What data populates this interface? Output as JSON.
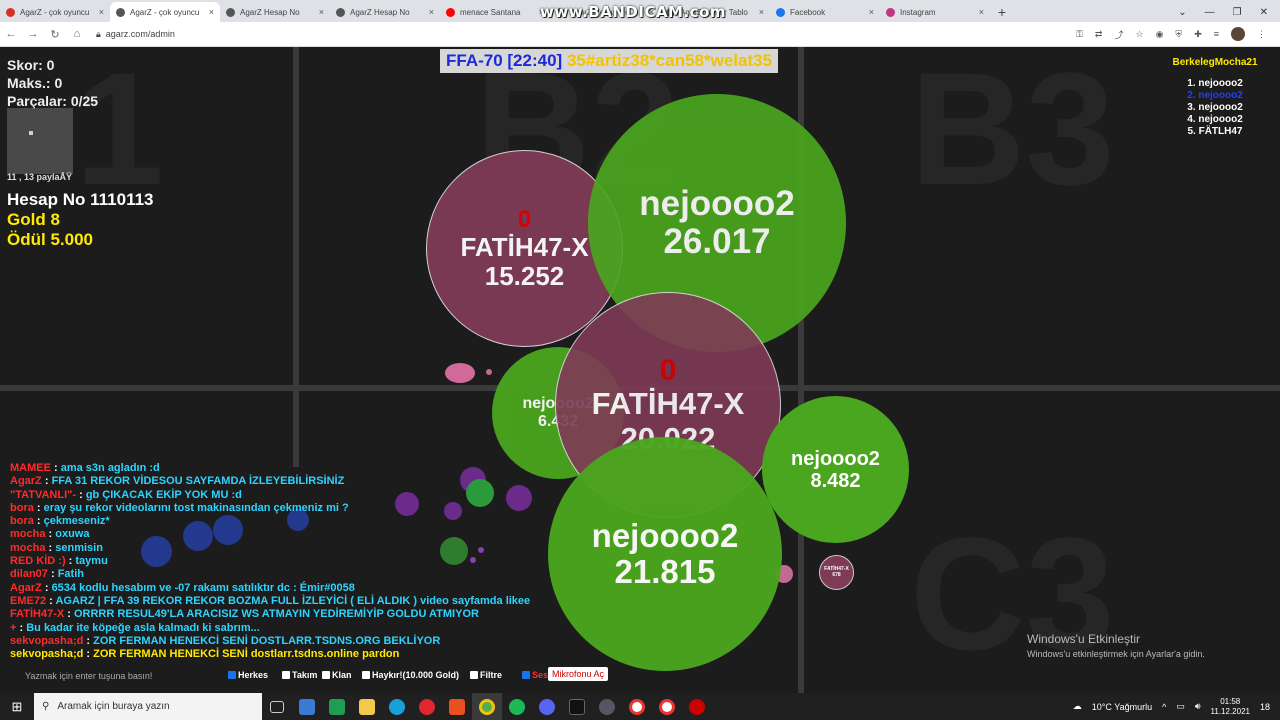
{
  "browser": {
    "tabs": [
      {
        "label": "AgarZ - çok oyuncu",
        "favicon": "#d93025",
        "active": false
      },
      {
        "label": "AgarZ - çok oyuncu",
        "favicon": "#555555",
        "active": true
      },
      {
        "label": "AgarZ Hesap No",
        "favicon": "#555555",
        "active": false
      },
      {
        "label": "AgarZ Hesap No",
        "favicon": "#555555",
        "active": false
      },
      {
        "label": "menace Santana",
        "favicon": "#ff0000",
        "active": false
      },
      {
        "label": "AgarZ Hesap No",
        "favicon": "#555555",
        "active": false
      },
      {
        "label": "AgarZ - Onur Tablo",
        "favicon": "#555555",
        "active": false
      },
      {
        "label": "Facebook",
        "favicon": "#1877f2",
        "active": false
      },
      {
        "label": "Instagram",
        "favicon": "#c13584",
        "active": false
      }
    ],
    "new_tab": "+",
    "window_controls": [
      "⌄",
      "—",
      "❐",
      "✕"
    ],
    "url": "agarz.com/admin",
    "watermark": "www.BANDICAM.com"
  },
  "hud": {
    "score": "Skor: 0",
    "max": "Maks.: 0",
    "pieces": "Parçalar: 0/25",
    "coords": "11 , 13 paylaÅŸ",
    "account": "Hesap No 1110113",
    "gold": "Gold 8",
    "reward": "Ödül 5.000"
  },
  "server_title": {
    "mode": "FFA-70 [22:40]",
    "names": "35#artiz38*can58*welat35"
  },
  "leaderboard": {
    "title": "BerkelegMocha21",
    "entries": [
      "1. nejoooo2",
      "2. nejoooo2",
      "3. nejoooo2",
      "4. nejoooo2",
      "5. FÄTLH47"
    ]
  },
  "cells": [
    {
      "name": "FATİH47-X",
      "mass": "15.252",
      "count": "0",
      "color": "#7f3b56"
    },
    {
      "name": "nejoooo2",
      "mass": "26.017",
      "count": "",
      "color": "#4aa61e"
    },
    {
      "name": "FATİH47-X",
      "mass": "20.022",
      "count": "0",
      "color": "#7f3b56"
    },
    {
      "name": "nejoooo2",
      "mass": "6.432",
      "count": "",
      "color": "#4aa61e"
    },
    {
      "name": "nejoooo2",
      "mass": "8.482",
      "count": "",
      "color": "#4aa61e"
    },
    {
      "name": "nejoooo2",
      "mass": "21.815",
      "count": "",
      "color": "#4aa61e"
    },
    {
      "name": "FATİH47-X",
      "mass": "678",
      "count": "",
      "color": "#7f3b56"
    }
  ],
  "sectors": [
    "1",
    "B2",
    "B3",
    "C3"
  ],
  "chat": [
    {
      "who": "MAMEE",
      "color": "#ff2b2b",
      "msg": "ama s3n agladın :d"
    },
    {
      "who": "AgarZ",
      "color": "#ff2b2b",
      "msg": "FFA 31 REKOR VİDESOU SAYFAMDA İZLEYEBİLİRSİNİZ"
    },
    {
      "who": "\"TATVANLI\"-",
      "color": "#ff2b2b",
      "msg": "gb ÇIKACAK EKİP YOK MU :d"
    },
    {
      "who": "bora",
      "color": "#ff2b2b",
      "msg": "eray şu rekor videolarını tost makinasından çekmeniz mi ?"
    },
    {
      "who": "bora",
      "color": "#ff2b2b",
      "msg": "çekmeseniz*"
    },
    {
      "who": "mocha",
      "color": "#ff2b2b",
      "msg": "oxuwa"
    },
    {
      "who": "mocha",
      "color": "#ff2b2b",
      "msg": "senmisin"
    },
    {
      "who": "RED KİD :)",
      "color": "#ff2b2b",
      "msg": "taymu"
    },
    {
      "who": "dilan07",
      "color": "#ff2b2b",
      "msg": "Fatih"
    },
    {
      "who": "AgarZ",
      "color": "#ff2b2b",
      "msg": "6534 kodlu hesabım ve -07 rakamı satılıktır dc : Émir#0058"
    },
    {
      "who": "EME72",
      "color": "#ff2b2b",
      "msg": "AGARZ | FFA 39 REKOR REKOR BOZMA FULL İZLEYİCİ ( ELİ ALDIK )  video sayfamda likee"
    },
    {
      "who": "FATİH47-X",
      "color": "#ff2b2b",
      "msg": "ORRRR RESUL49'LA ARACISIZ WS ATMAYIN YEDİREMİYİP GOLDU ATMIYOR"
    },
    {
      "who": "+",
      "color": "#ff2b2b",
      "msg": "Bu kadar ite köpeğe asla kalmadı ki sabrım..."
    },
    {
      "who": "sekvopasha;d",
      "color": "#ff2b2b",
      "msg": "ZOR FERMAN HENEKCİ SENİ DOSTLARR.TSDNS.ORG BEKLİYOR"
    },
    {
      "who": "sekvopasha;d",
      "color": "#ffea00",
      "msg": "ZOR FERMAN HENEKCİ SENİ  dostlarr.tsdns.online pardon"
    }
  ],
  "bottom": {
    "chat_placeholder": "Yazmak için enter tuşuna basın!",
    "checkboxes": [
      {
        "label": "Herkes",
        "checked": true
      },
      {
        "label": "Takım",
        "checked": false
      },
      {
        "label": "Klan",
        "checked": false
      },
      {
        "label": "Haykır!(10.000 Gold)",
        "checked": false
      },
      {
        "label": "Filtre",
        "checked": false
      },
      {
        "label": "Ses",
        "checked": true
      }
    ],
    "mic_button": "Mikrofonu Aç"
  },
  "windows_activation": {
    "title": "Windows'u Etkinleştir",
    "subtitle": "Windows'u etkinleştirmek için Ayarlar'a gidin."
  },
  "taskbar": {
    "search_placeholder": "Aramak için buraya yazın",
    "weather": "10°C  Yağmurlu",
    "time": "01:58",
    "date": "11.12.2021",
    "notification_count": "18"
  }
}
